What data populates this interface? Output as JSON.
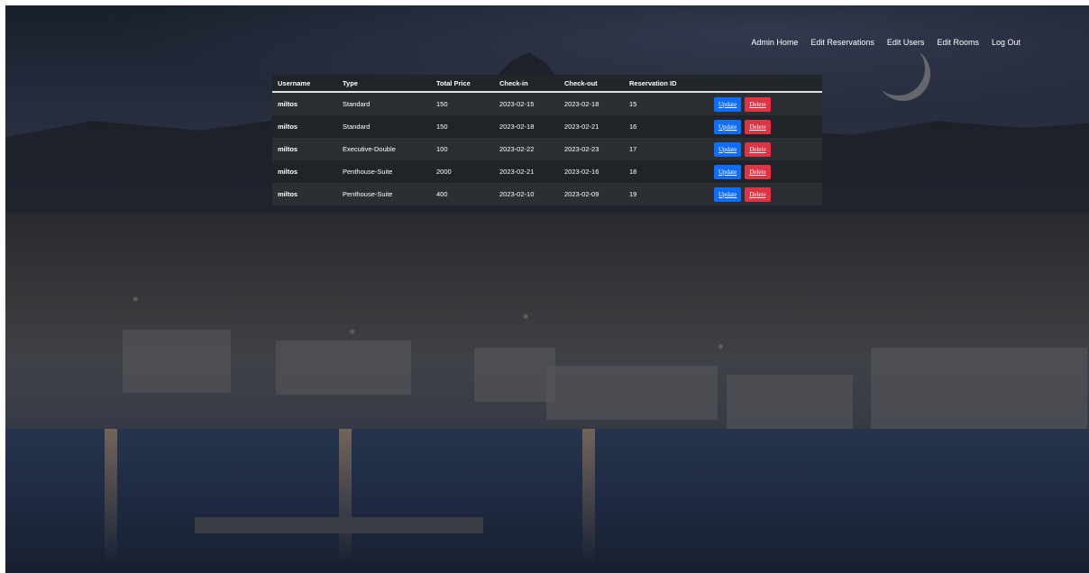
{
  "nav": {
    "items": [
      "Admin Home",
      "Edit Reservations",
      "Edit Users",
      "Edit Rooms",
      "Log Out"
    ]
  },
  "table": {
    "headers": [
      "Username",
      "Type",
      "Total Price",
      "Check-in",
      "Check-out",
      "Reservation ID",
      ""
    ],
    "rows": [
      {
        "username": "miltos",
        "type": "Standard",
        "total_price": "150",
        "check_in": "2023-02-15",
        "check_out": "2023-02-18",
        "reservation_id": "15",
        "update": "Update",
        "delete": "Delete"
      },
      {
        "username": "miltos",
        "type": "Standard",
        "total_price": "150",
        "check_in": "2023-02-18",
        "check_out": "2023-02-21",
        "reservation_id": "16",
        "update": "Update",
        "delete": "Delete"
      },
      {
        "username": "miltos",
        "type": "Executive-Double",
        "total_price": "100",
        "check_in": "2023-02-22",
        "check_out": "2023-02-23",
        "reservation_id": "17",
        "update": "Update",
        "delete": "Delete"
      },
      {
        "username": "miltos",
        "type": "Penthouse-Suite",
        "total_price": "2000",
        "check_in": "2023-02-21",
        "check_out": "2023-02-16",
        "reservation_id": "18",
        "update": "Update",
        "delete": "Delete"
      },
      {
        "username": "miltos",
        "type": "Penthouse-Suite",
        "total_price": "400",
        "check_in": "2023-02-10",
        "check_out": "2023-02-09",
        "reservation_id": "19",
        "update": "Update",
        "delete": "Delete"
      }
    ]
  },
  "colors": {
    "update_button": "#0d6efd",
    "delete_button": "#dc3545",
    "table_background": "#212529"
  }
}
